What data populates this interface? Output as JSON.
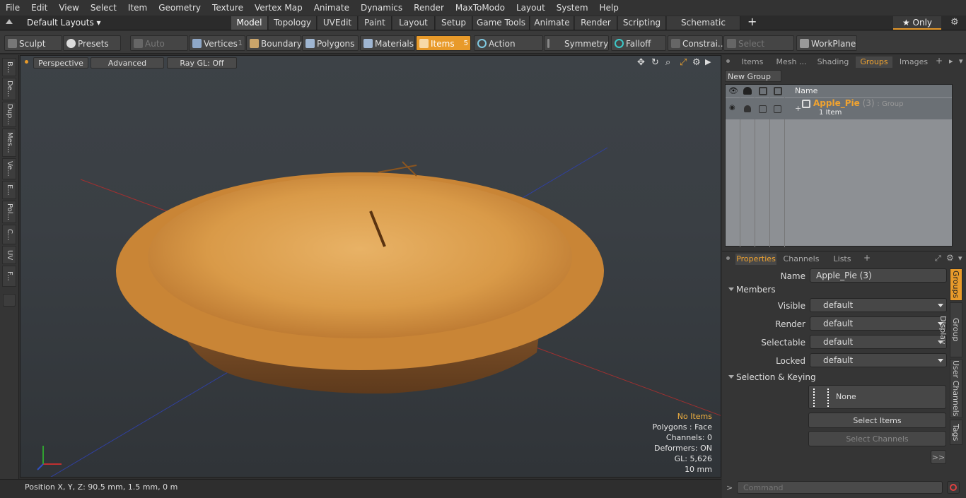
{
  "menu": [
    "File",
    "Edit",
    "View",
    "Select",
    "Item",
    "Geometry",
    "Texture",
    "Vertex Map",
    "Animate",
    "Dynamics",
    "Render",
    "MaxToModo",
    "Layout",
    "System",
    "Help"
  ],
  "layout_selector": "Default Layouts ▾",
  "mode_tabs": [
    "Model",
    "Topology",
    "UVEdit",
    "Paint",
    "Layout",
    "Setup",
    "Game Tools",
    "Animate",
    "Render",
    "Scripting",
    "Schematic Fusion"
  ],
  "mode_add": "+",
  "only_label": "★ Only",
  "toolbar": {
    "sculpt": "Sculpt",
    "presets": "Presets",
    "auto_select": "Auto Select",
    "vertices": "Vertices",
    "vertices_count": "1",
    "boundary": "Boundary",
    "polygons": "Polygons",
    "materials": "Materials",
    "items": "Items",
    "items_count": "5",
    "action_center": "Action Center",
    "symmetry": "Symmetry",
    "falloff": "Falloff",
    "constraints": "Constrai...",
    "select_through": "Select Through",
    "workplane": "WorkPlane"
  },
  "left_tabs": [
    "B...",
    "De...",
    "Dup...",
    "Mes...",
    "Ve...",
    "E...",
    "Pol...",
    "C...",
    "UV",
    "F..."
  ],
  "viewport": {
    "perspective": "Perspective",
    "advanced": "Advanced",
    "raygl": "Ray GL: Off",
    "hud": {
      "no_items": "No Items",
      "polygons": "Polygons : Face",
      "channels": "Channels: 0",
      "deformers": "Deformers: ON",
      "gl": "GL: 5,626",
      "scale": "10 mm"
    }
  },
  "statusbar": "Position X, Y, Z:   90.5 mm, 1.5 mm, 0 m",
  "right_tabs": [
    "Items",
    "Mesh ...",
    "Shading",
    "Groups",
    "Images"
  ],
  "new_group": "New Group",
  "group_list": {
    "name_header": "Name",
    "group_name": "Apple_Pie",
    "group_count": "(3)",
    "group_type": ": Group",
    "group_sub": "1 Item"
  },
  "prop_tabs": [
    "Properties",
    "Channels",
    "Lists"
  ],
  "props": {
    "name_label": "Name",
    "name_value": "Apple_Pie (3)",
    "members": "Members",
    "visible_label": "Visible",
    "visible_value": "default",
    "render_label": "Render",
    "render_value": "default",
    "selectable_label": "Selectable",
    "selectable_value": "default",
    "locked_label": "Locked",
    "locked_value": "default",
    "sel_keying": "Selection & Keying",
    "none": "None",
    "select_items": "Select Items",
    "select_channels": "Select Channels",
    "more": ">>"
  },
  "right_vtabs": [
    "Groups",
    "Group Display",
    "User Channels",
    "Tags"
  ],
  "command_placeholder": "Command",
  "colors": {
    "accent": "#e89a2a",
    "group_name": "#f0a330"
  }
}
